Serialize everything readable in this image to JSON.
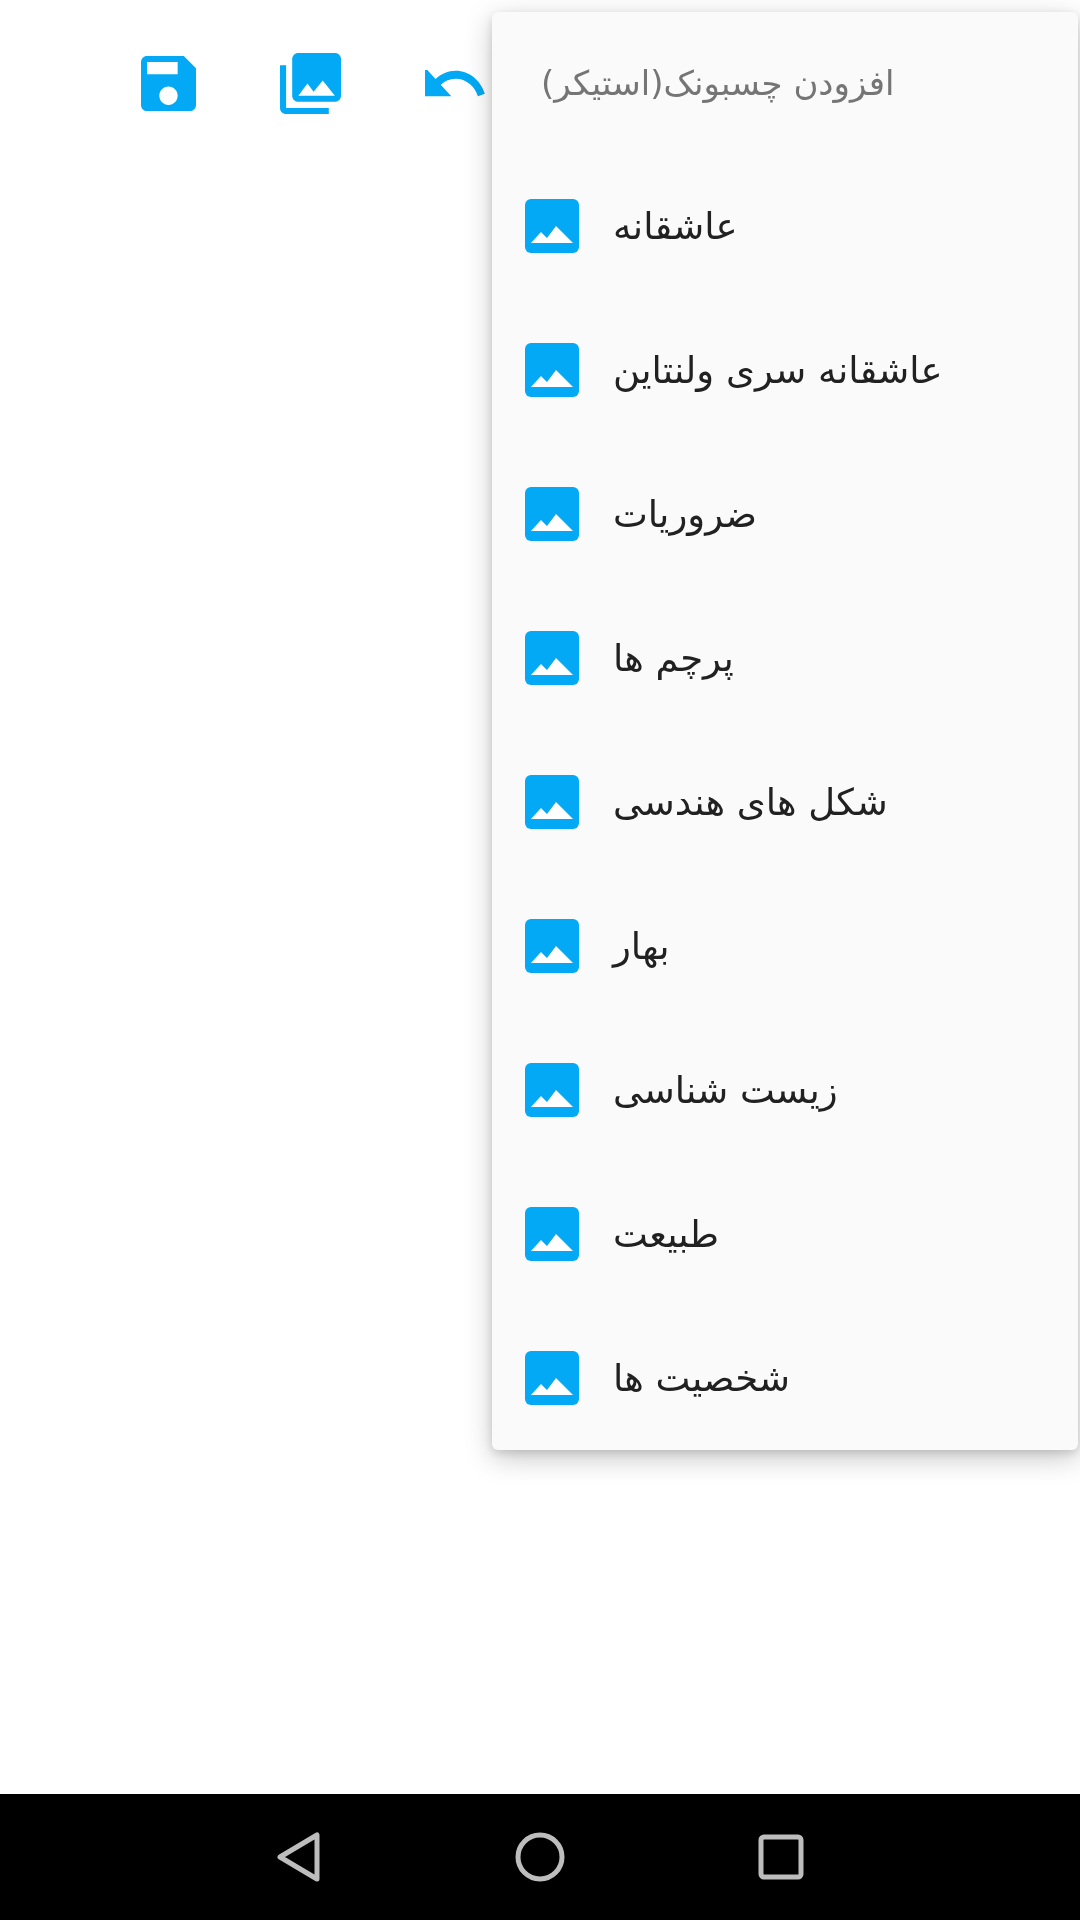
{
  "menu": {
    "title": "افزودن چسبونک(استیکر)",
    "items": [
      "عاشقانه",
      "عاشقانه سری ولنتاین",
      "ضروریات",
      "پرچم ها",
      "شکل های هندسی",
      "بهار",
      "زیست شناسی",
      "طبیعت",
      "شخصیت ها"
    ]
  }
}
